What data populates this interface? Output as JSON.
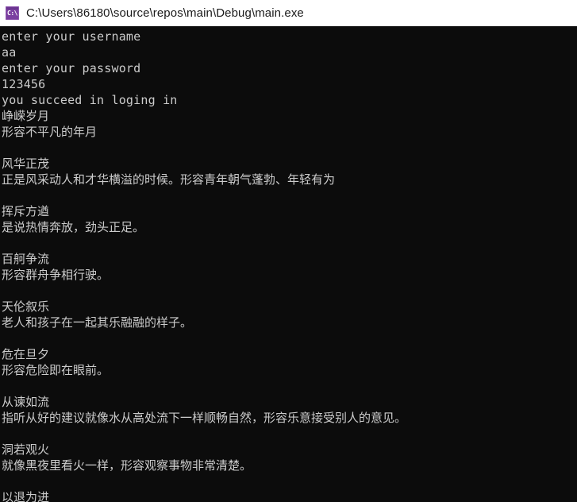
{
  "window": {
    "title": "C:\\Users\\86180\\source\\repos\\main\\Debug\\main.exe",
    "icon": "console-app-icon",
    "icon_glyph": "C:\\",
    "titlebar_color": "#ffffff",
    "titlebar_text_color": "#1a1a1a",
    "background_color": "#0c0c0c",
    "text_color": "#cccccc",
    "accent_color": "#7b3fa0"
  },
  "console": {
    "lines": [
      "enter your username",
      "aa",
      "enter your password",
      "123456",
      "you succeed in loging in",
      "峥嵘岁月",
      "形容不平凡的年月",
      "",
      "风华正茂",
      "正是风采动人和才华横溢的时候。形容青年朝气蓬勃、年轻有为",
      "",
      "挥斥方遒",
      "是说热情奔放，劲头正足。",
      "",
      "百舸争流",
      "形容群舟争相行驶。",
      "",
      "天伦叙乐",
      "老人和孩子在一起其乐融融的样子。",
      "",
      "危在旦夕",
      "形容危险即在眼前。",
      "",
      "从谏如流",
      "指听从好的建议就像水从高处流下一样顺畅自然，形容乐意接受别人的意见。",
      "",
      "洞若观火",
      "就像黑夜里看火一样，形容观察事物非常清楚。",
      "",
      "以退为进"
    ]
  }
}
